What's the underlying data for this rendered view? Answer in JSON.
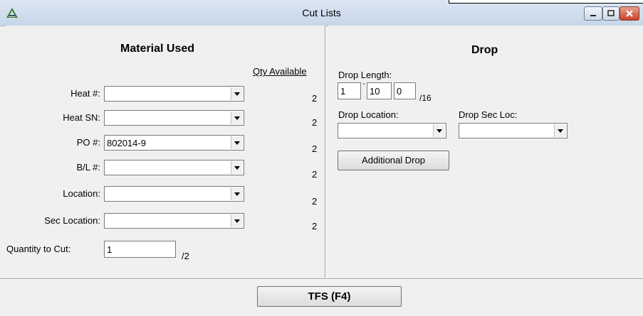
{
  "window": {
    "title": "Cut Lists"
  },
  "material": {
    "heading": "Material Used",
    "qty_header": "Qty Available",
    "rows": [
      {
        "label": "Heat #:",
        "value": "",
        "qty": "2"
      },
      {
        "label": "Heat SN:",
        "value": "",
        "qty": "2"
      },
      {
        "label": "PO #:",
        "value": "802014-9",
        "qty": "2"
      },
      {
        "label": "B/L #:",
        "value": "",
        "qty": "2"
      },
      {
        "label": "Location:",
        "value": "",
        "qty": "2"
      },
      {
        "label": "Sec Location:",
        "value": "",
        "qty": "2"
      }
    ],
    "quantity_label": "Quantity to Cut:",
    "quantity_value": "1",
    "quantity_total": "/2"
  },
  "drop": {
    "heading": "Drop",
    "length_label": "Drop Length:",
    "length_feet": "1",
    "feet_mark": "'",
    "length_inches": "10",
    "length_fraction": "0",
    "fraction_suffix": "/16",
    "location_label": "Drop Location:",
    "location_value": "",
    "sec_loc_label": "Drop Sec Loc:",
    "sec_loc_value": "",
    "additional_button": "Additional Drop"
  },
  "footer": {
    "tfs_button": "TFS (F4)"
  }
}
